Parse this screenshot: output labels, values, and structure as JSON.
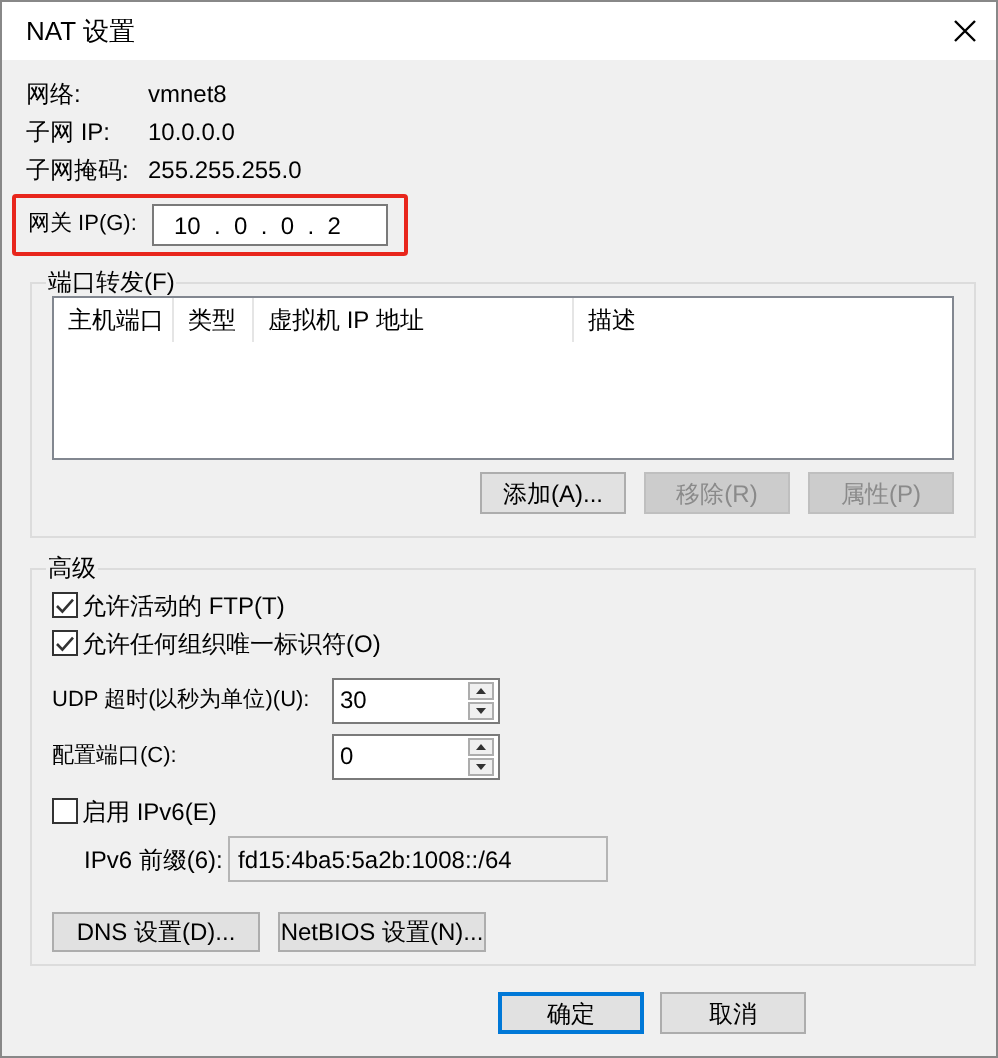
{
  "window": {
    "title": "NAT 设置"
  },
  "info": [
    {
      "label": "网络:",
      "value": "vmnet8"
    },
    {
      "label": "子网 IP:",
      "value": "10.0.0.0"
    },
    {
      "label": "子网掩码:",
      "value": "255.255.255.0"
    }
  ],
  "gateway": {
    "label": "网关 IP(G):",
    "value": "10  .  0  .  0  .  2",
    "highlighted": true
  },
  "port_forwarding": {
    "title": "端口转发(F)",
    "columns": [
      "主机端口",
      "类型",
      "虚拟机 IP 地址",
      "描述"
    ],
    "buttons": [
      {
        "label": "添加(A)...",
        "disabled": false
      },
      {
        "label": "移除(R)",
        "disabled": true
      },
      {
        "label": "属性(P)",
        "disabled": true
      }
    ]
  },
  "advanced": {
    "title": "高级",
    "options": [
      {
        "kind": "checkbox",
        "label": "允许活动的 FTP(T)",
        "checked": true
      },
      {
        "kind": "checkbox",
        "label": "允许任何组织唯一标识符(O)",
        "checked": true
      },
      {
        "kind": "spinner",
        "label": "UDP 超时(以秒为单位)(U):",
        "value": "30"
      },
      {
        "kind": "spinner",
        "label": "配置端口(C):",
        "value": "0"
      },
      {
        "kind": "checkbox",
        "label": "启用 IPv6(E)",
        "checked": false
      },
      {
        "kind": "field",
        "label": "IPv6 前缀(6):",
        "value": "fd15:4ba5:5a2b:1008::/64",
        "disabled": true
      }
    ],
    "buttons": [
      "DNS 设置(D)...",
      "NetBIOS 设置(N)..."
    ]
  },
  "footer_buttons": [
    {
      "label": "确定",
      "default": true
    },
    {
      "label": "取消",
      "default": false
    }
  ]
}
